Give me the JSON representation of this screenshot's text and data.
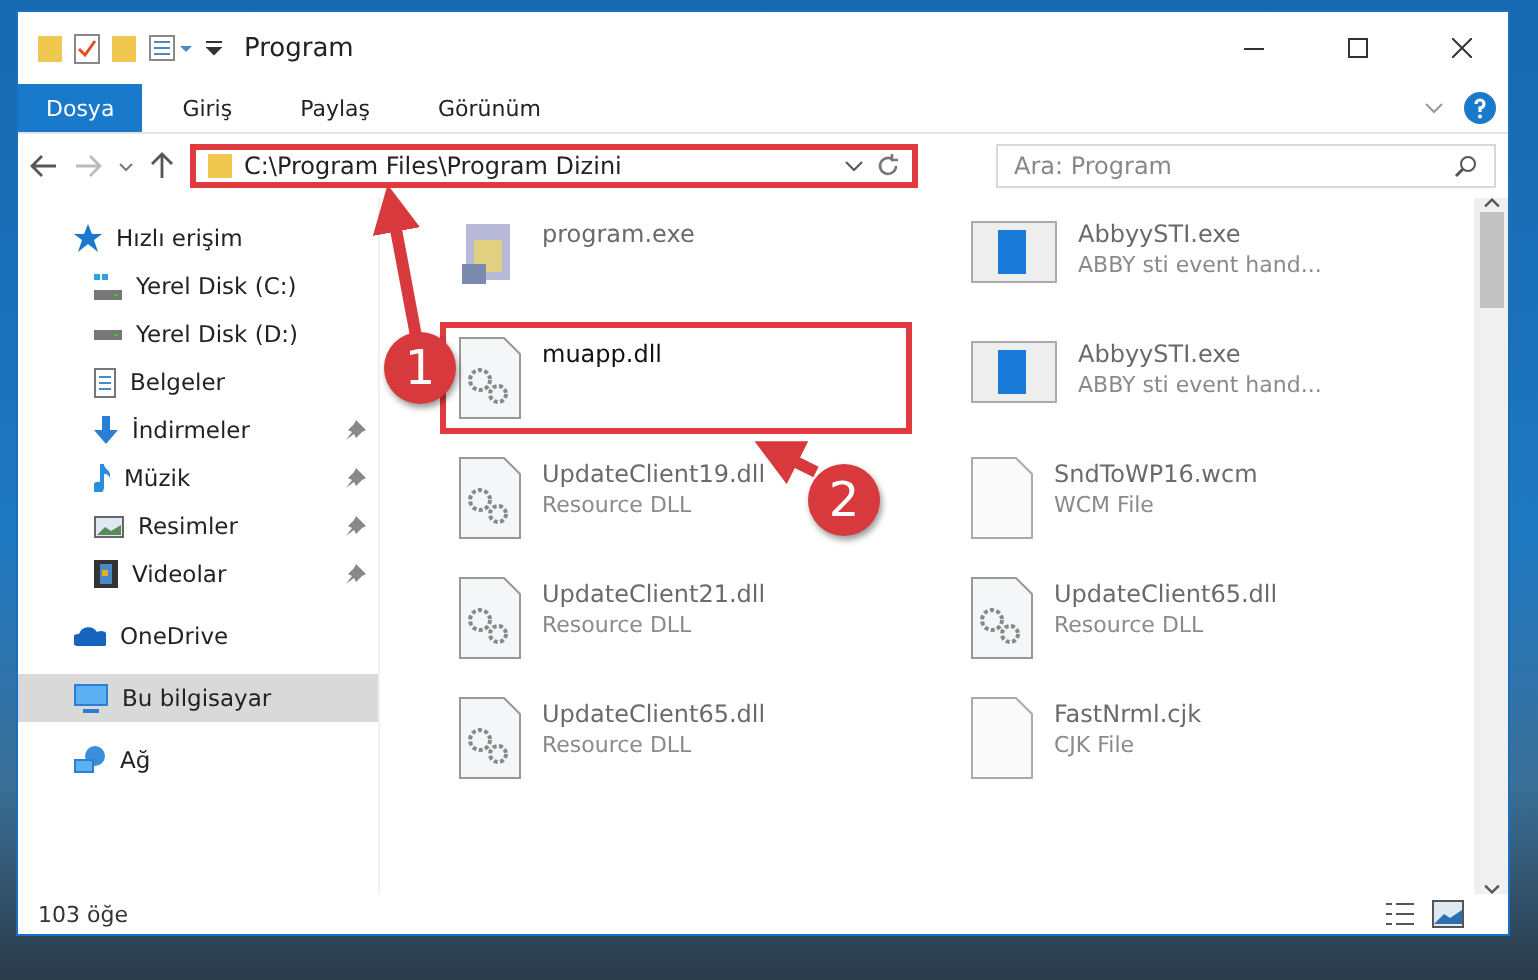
{
  "window": {
    "title": "Program"
  },
  "ribbon_tabs": [
    {
      "label": "Dosya",
      "selected": true
    },
    {
      "label": "Giriş",
      "selected": false
    },
    {
      "label": "Paylaş",
      "selected": false
    },
    {
      "label": "Görünüm",
      "selected": false
    }
  ],
  "address_bar": {
    "path": "C:\\Program Files\\Program Dizini",
    "highlighted": true
  },
  "search": {
    "placeholder": "Ara: Program"
  },
  "sidebar": {
    "items": [
      {
        "label": "Hızlı erişim",
        "pinned": false,
        "selected": false,
        "children": [
          {
            "label": "Yerel Disk (C:)",
            "pinned": false,
            "selected": false
          },
          {
            "label": "Yerel Disk (D:)",
            "pinned": false,
            "selected": false
          },
          {
            "label": "Belgeler",
            "pinned": false,
            "selected": false
          },
          {
            "label": "İndirmeler",
            "pinned": true,
            "selected": false
          },
          {
            "label": "Müzik",
            "pinned": true,
            "selected": false
          },
          {
            "label": "Resimler",
            "pinned": true,
            "selected": false
          },
          {
            "label": "Videolar",
            "pinned": true,
            "selected": false
          }
        ]
      },
      {
        "label": "OneDrive",
        "pinned": false,
        "selected": false
      },
      {
        "label": "Bu bilgisayar",
        "pinned": false,
        "selected": true
      },
      {
        "label": "Ağ",
        "pinned": false,
        "selected": false
      }
    ]
  },
  "files": [
    {
      "name": "program.exe",
      "kind": "exe",
      "blurred": true,
      "highlighted": false
    },
    {
      "name": "AbbyySTI.exe",
      "type": "ABBY sti event hand...",
      "kind": "app",
      "blurred": true,
      "highlighted": false
    },
    {
      "name": "muapp.dll",
      "kind": "dll",
      "blurred": false,
      "highlighted": true
    },
    {
      "name": "AbbyySTI.exe",
      "type": "ABBY sti event hand...",
      "kind": "app",
      "blurred": true,
      "highlighted": false
    },
    {
      "name": "UpdateClient19.dll",
      "type": "Resource DLL",
      "kind": "dll",
      "blurred": true,
      "highlighted": false
    },
    {
      "name": "SndToWP16.wcm",
      "type": "WCM File",
      "kind": "file",
      "blurred": true,
      "highlighted": false
    },
    {
      "name": "UpdateClient21.dll",
      "type": "Resource DLL",
      "kind": "dll",
      "blurred": true,
      "highlighted": false
    },
    {
      "name": "UpdateClient65.dll",
      "type": "Resource DLL",
      "kind": "dll",
      "blurred": true,
      "highlighted": false
    },
    {
      "name": "UpdateClient65.dll",
      "type": "Resource DLL",
      "kind": "dll",
      "blurred": true,
      "highlighted": false
    },
    {
      "name": "FastNrml.cjk",
      "type": "CJK File",
      "kind": "file",
      "blurred": true,
      "highlighted": false
    }
  ],
  "status_bar": {
    "count": "103 öğe"
  },
  "annotations": [
    {
      "number": "1"
    },
    {
      "number": "2"
    }
  ]
}
